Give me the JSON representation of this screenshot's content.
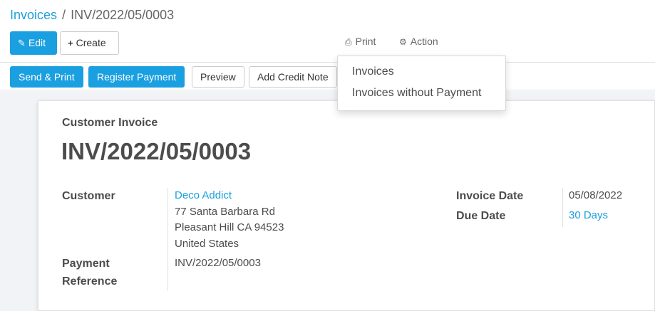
{
  "breadcrumb": {
    "parent": "Invoices",
    "separator": "/",
    "current": "INV/2022/05/0003"
  },
  "toolbar": {
    "edit_label": "Edit",
    "create_label": "Create",
    "print_label": "Print",
    "action_label": "Action"
  },
  "icons": {
    "edit": "pencil-icon",
    "create": "plus-icon",
    "print": "printer-icon",
    "action": "gear-icon"
  },
  "statusbar": {
    "send_print": "Send & Print",
    "register_payment": "Register Payment",
    "preview": "Preview",
    "add_credit_note": "Add Credit Note"
  },
  "print_menu": {
    "items": [
      "Invoices",
      "Invoices without Payment"
    ]
  },
  "form": {
    "doc_type": "Customer Invoice",
    "doc_name": "INV/2022/05/0003",
    "customer_label": "Customer",
    "customer_name": "Deco Addict",
    "customer_address": [
      "77 Santa Barbara Rd",
      "Pleasant Hill CA 94523",
      "United States"
    ],
    "payment_reference_label_1": "Payment",
    "payment_reference_label_2": "Reference",
    "payment_reference": "INV/2022/05/0003",
    "invoice_date_label": "Invoice Date",
    "invoice_date": "05/08/2022",
    "due_date_label": "Due Date",
    "due_date": "30 Days"
  },
  "colors": {
    "primary": "#1a9fe0",
    "text": "#4c4c4c",
    "background": "#f1f3f6"
  }
}
